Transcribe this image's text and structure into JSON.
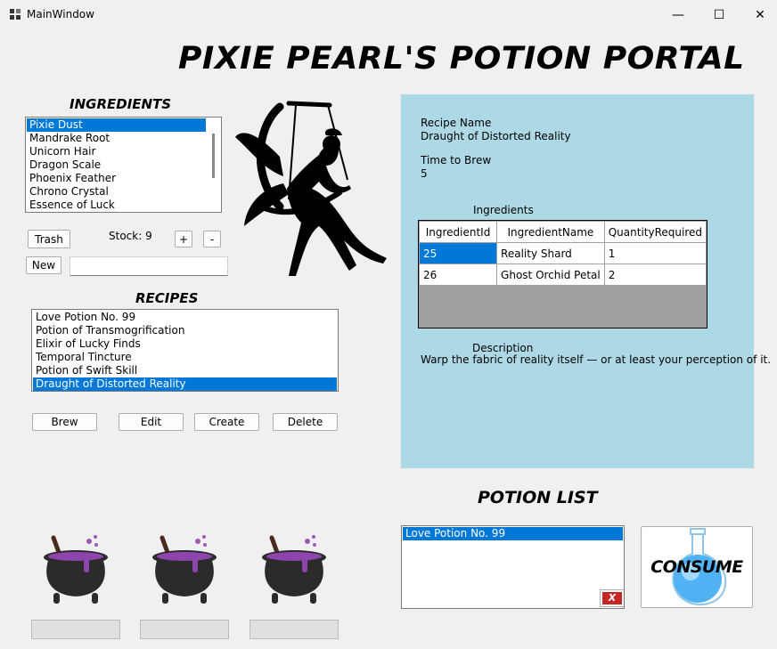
{
  "window": {
    "title": "MainWindow",
    "minimize_symbol": "—",
    "maximize_symbol": "☐",
    "close_symbol": "✕"
  },
  "banner": "PIXIE PEARL'S POTION PORTAL",
  "ingredients": {
    "title": "INGREDIENTS",
    "items": [
      "Pixie Dust",
      "Mandrake Root",
      "Unicorn Hair",
      "Dragon Scale",
      "Phoenix Feather",
      "Chrono Crystal",
      "Essence of Luck"
    ],
    "selected_index": 0,
    "trash_label": "Trash",
    "stock_text": "Stock: 9",
    "plus_label": "+",
    "minus_label": "-",
    "new_label": "New",
    "new_value": ""
  },
  "recipes": {
    "title": "RECIPES",
    "items": [
      "Love Potion No. 99",
      "Potion of Transmogrification",
      "Elixir of Lucky Finds",
      "Temporal Tincture",
      "Potion of Swift Skill",
      "Draught of Distorted Reality"
    ],
    "selected_index": 5,
    "brew_label": "Brew",
    "edit_label": "Edit",
    "create_label": "Create",
    "delete_label": "Delete"
  },
  "recipe_detail": {
    "name_label": "Recipe Name",
    "name_value": "Draught of Distorted Reality",
    "time_label": "Time to Brew",
    "time_value": "5",
    "ingredients_label": "Ingredients",
    "columns": [
      "IngredientId",
      "IngredientName",
      "QuantityRequired"
    ],
    "rows": [
      [
        "25",
        "Reality Shard",
        "1"
      ],
      [
        "26",
        "Ghost Orchid Petal",
        "2"
      ]
    ],
    "description_label": "Description",
    "description_value": "Warp the fabric of reality itself — or at least your perception of it."
  },
  "potion_list": {
    "title": "POTION LIST",
    "items": [
      "Love Potion No. 99"
    ],
    "selected_index": 0,
    "delete_label": "X",
    "consume_label": "CONSUME"
  },
  "cauldrons": [
    {
      "status": ""
    },
    {
      "status": ""
    },
    {
      "status": ""
    }
  ],
  "colors": {
    "panel": "#add8e6",
    "selection": "#0078d7",
    "potion_purple": "#8e44ad",
    "x_button": "#c62828"
  }
}
